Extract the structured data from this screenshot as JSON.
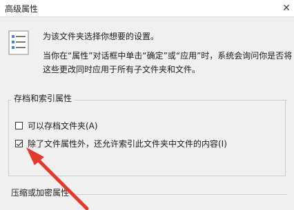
{
  "window": {
    "title": "高级属性",
    "close_glyph": "✕"
  },
  "description": {
    "line1": "为该文件夹选择你想要的设置。",
    "line2": "当你在“属性”对话框中单击“确定”或“应用”时，系统会询问你是否将这些更改同时应用于所有子文件夹和文件。"
  },
  "archive_group": {
    "label": "存档和索引属性",
    "options": [
      {
        "label": "可以存档文件夹(A)",
        "checked": false
      },
      {
        "label": "除了文件属性外，还允许索引此文件夹中文件的内容(I)",
        "checked": true
      }
    ]
  },
  "compress_group": {
    "label": "压缩或加密属性"
  },
  "annotation": {
    "arrow_color": "#e23b2e"
  }
}
